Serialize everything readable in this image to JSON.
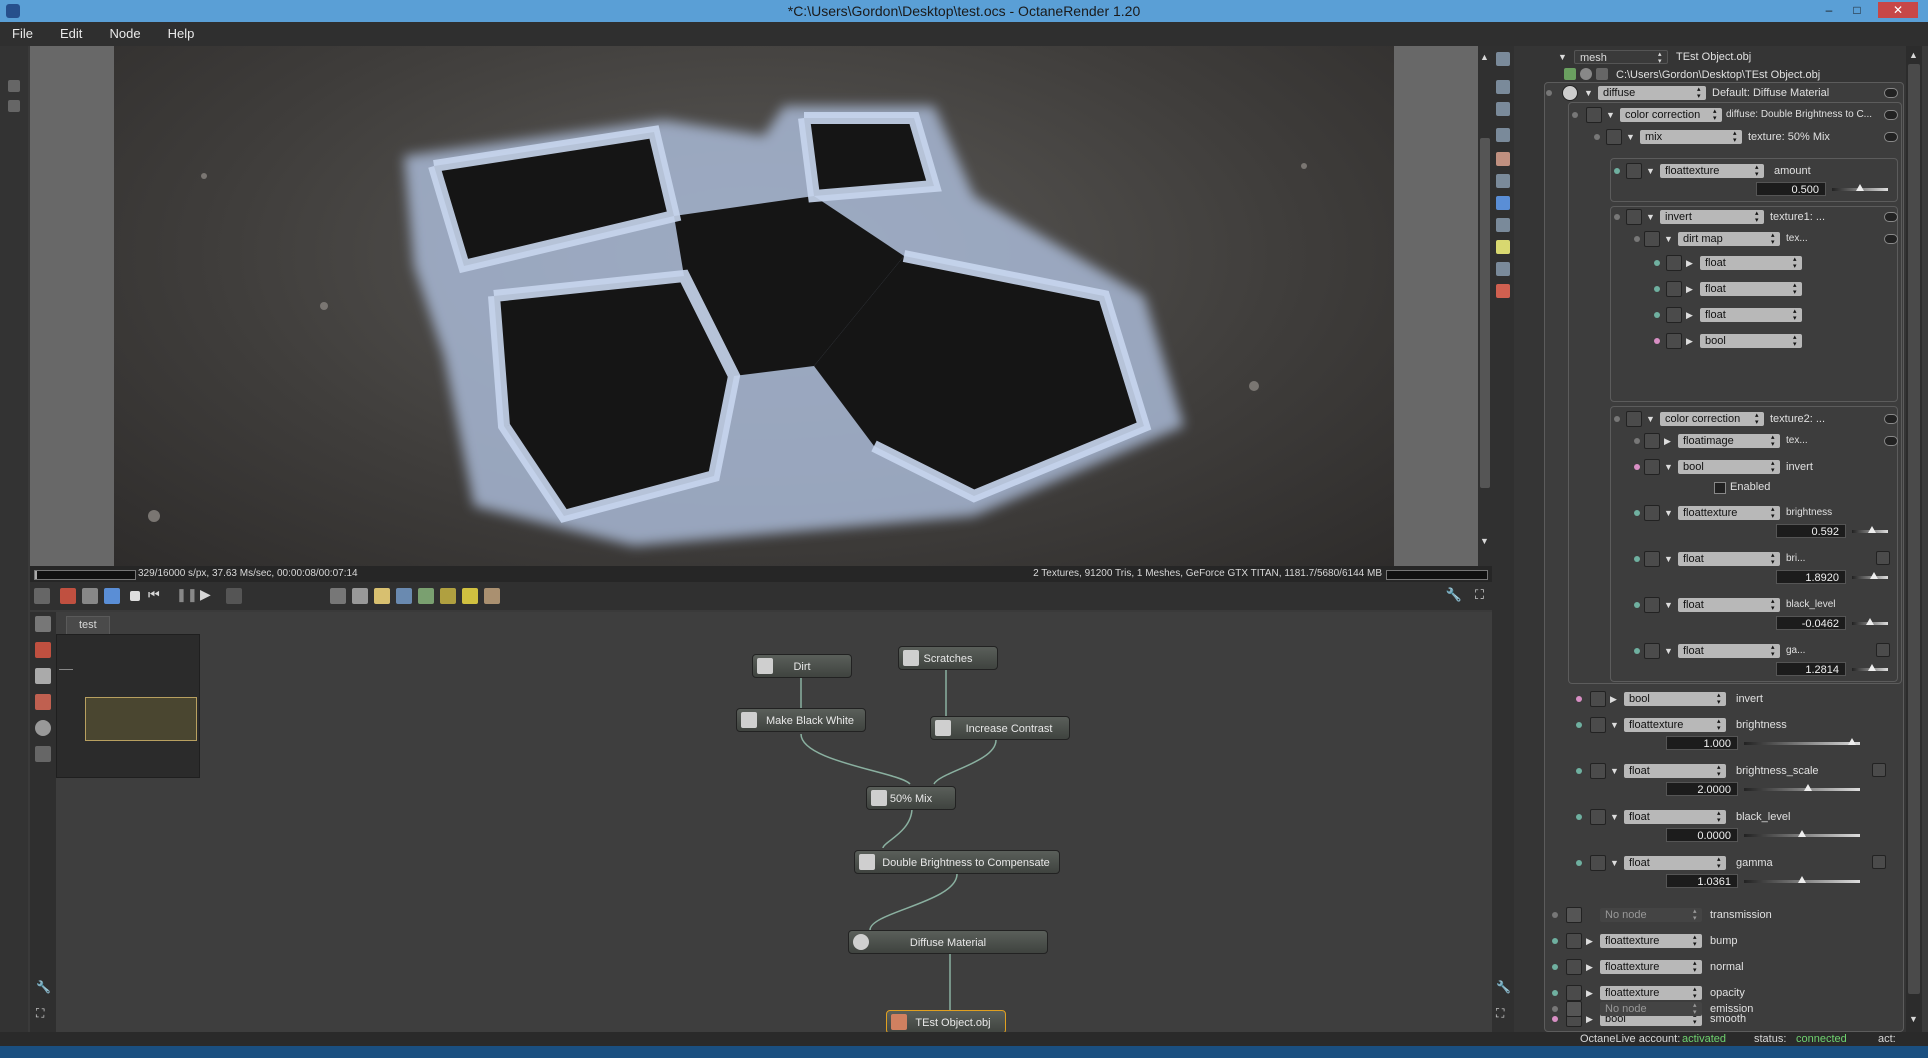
{
  "window": {
    "title": "*C:\\Users\\Gordon\\Desktop\\test.ocs - OctaneRender 1.20",
    "min": "–",
    "max": "□",
    "close": "✕"
  },
  "menu": [
    "File",
    "Edit",
    "Node",
    "Help"
  ],
  "status": {
    "left": "329/16000 s/px, 37.63 Ms/sec, 00:00:08/00:07:14",
    "right": "2 Textures, 91200 Tris, 1 Meshes, GeForce GTX TITAN, 1181.7/5680/6144 MB"
  },
  "editor": {
    "tab": "test",
    "nodes": {
      "dirt": "Dirt",
      "scratches": "Scratches",
      "make_bw": "Make Black White",
      "contrast": "Increase Contrast",
      "mix": "50% Mix",
      "double": "Double Brightness to Compensate",
      "diffuse": "Diffuse Material",
      "object": "TEst Object.obj"
    }
  },
  "inspector": {
    "mesh_type": "mesh",
    "mesh_name": "TEst Object.obj",
    "mesh_path": "C:\\Users\\Gordon\\Desktop\\TEst Object.obj",
    "diffuse_type": "diffuse",
    "diffuse_name": "Default: Diffuse Material",
    "cc_type": "color correction",
    "cc_name": "diffuse: Double Brightness to C...",
    "mix_type": "mix",
    "mix_name": "texture: 50% Mix",
    "ft_type": "floattexture",
    "ft_label": "amount",
    "ft_value": "0.500",
    "inv_type": "invert",
    "inv_label": "texture1: ...",
    "dirt_type": "dirt map",
    "dirt_label": "tex...",
    "float": "float",
    "bool": "bool",
    "cc2_type": "color correction",
    "cc2_label": "texture2: ...",
    "fi_type": "floatimage",
    "fi_label": "tex...",
    "b_invert_label": "invert",
    "enabled": "Enabled",
    "brightness_label": "brightness",
    "brightness_val": "0.592",
    "bri_label": "bri...",
    "bri_val": "1.8920",
    "black_label": "black_level",
    "black_val": "-0.0462",
    "ga_label": "ga...",
    "ga_val": "1.2814",
    "o_invert": "invert",
    "o_brightness": "brightness",
    "o_brightness_val": "1.000",
    "o_bscale": "brightness_scale",
    "o_bscale_val": "2.0000",
    "o_black": "black_level",
    "o_black_val": "0.0000",
    "o_gamma": "gamma",
    "o_gamma_val": "1.0361",
    "no_node": "No node",
    "transmission": "transmission",
    "bump": "bump",
    "normal": "normal",
    "opacity": "opacity",
    "smooth": "smooth",
    "emission": "emission"
  },
  "footer": {
    "account_label": "OctaneLive account:",
    "account": "activated",
    "status_label": "status:",
    "status": "connected",
    "act": "act:"
  },
  "colors": {
    "accent": "#5a9fd6",
    "good": "#6fd36f",
    "pin_pink": "#d88fc4",
    "pin_teal": "#6fb0a0"
  }
}
